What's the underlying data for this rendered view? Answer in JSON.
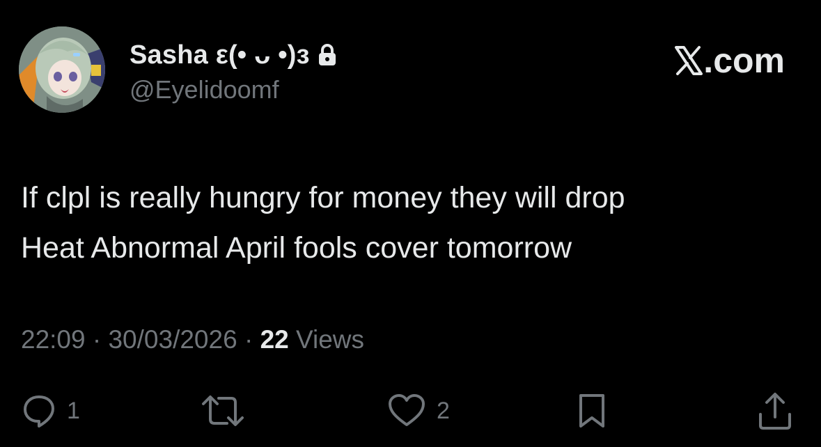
{
  "author": {
    "display_name": "Sasha ε(• ᴗ •)з",
    "handle": "@Eyelidoomf",
    "protected_icon": "lock-icon",
    "avatar": "anime-character-avatar"
  },
  "brand": {
    "label": ".com",
    "logo_icon": "x-logo-icon"
  },
  "tweet": {
    "lines": [
      "If clpl is really hungry for money they will drop",
      "Heat Abnormal April fools cover tomorrow"
    ],
    "time": "22:09",
    "separator": "·",
    "date": "30/03/2026",
    "views_count": "22",
    "views_label": "Views"
  },
  "actions": {
    "reply": {
      "icon": "reply-icon",
      "count": "1"
    },
    "retweet": {
      "icon": "retweet-icon",
      "count": ""
    },
    "like": {
      "icon": "heart-icon",
      "count": "2"
    },
    "bookmark": {
      "icon": "bookmark-icon"
    },
    "share": {
      "icon": "share-icon"
    }
  },
  "colors": {
    "background": "#000000",
    "primary_text": "#e7e9ea",
    "secondary_text": "#71767b"
  }
}
